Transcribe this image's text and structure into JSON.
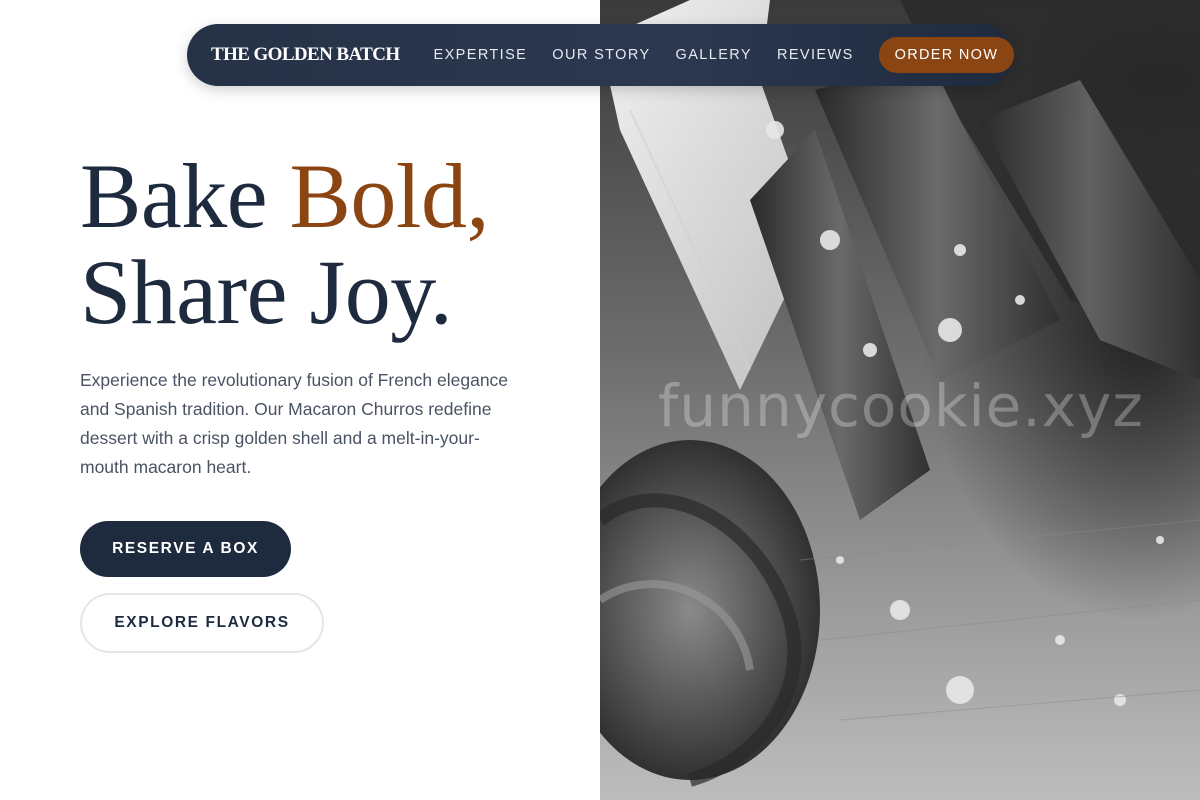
{
  "nav": {
    "brand": "THE GOLDEN BATCH",
    "links": [
      "EXPERTISE",
      "OUR STORY",
      "GALLERY",
      "REVIEWS"
    ],
    "cta": "ORDER NOW"
  },
  "hero": {
    "headline_part1": "Bake ",
    "headline_accent": "Bold,",
    "headline_line2": "Share Joy.",
    "intro": "Experience the revolutionary fusion of French elegance and Spanish tradition. Our Macaron Churros redefine dessert with a crisp golden shell and a melt-in-your-mouth macaron heart.",
    "primary_button": "RESERVE A BOX",
    "secondary_button": "EXPLORE FLAVORS",
    "image_watermark": "funnycookie.xyz"
  },
  "colors": {
    "navy": "#1e2a3e",
    "accent_brown": "#8b4513",
    "body_text": "#4a5363"
  }
}
